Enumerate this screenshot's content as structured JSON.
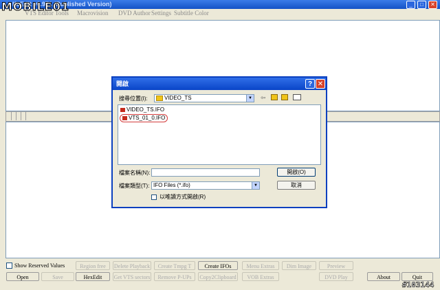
{
  "window": {
    "title": "IfoEdit v0.971 (Published Version)",
    "controls": {
      "minimize": "_",
      "maximize": "□",
      "close": "✕"
    }
  },
  "watermark": {
    "logo": "MOBILE01",
    "id": "#103144"
  },
  "menu": [
    "VTS Editor",
    "Tools",
    "Macrovision",
    "DVD Author",
    "Settings",
    "Subtitle Color"
  ],
  "dialog": {
    "title": "開啟",
    "look_in_label": "搜尋位置(I):",
    "look_in_value": "VIDEO_TS",
    "files": [
      "VIDEO_TS.IFO",
      "VTS_01_0.IFO"
    ],
    "filename_label": "檔案名稱(N):",
    "filename_value": "",
    "filetype_label": "檔案類型(T):",
    "filetype_value": "IFO Files (*.ifo)",
    "readonly_label": "以唯讀方式開啟(R)",
    "open_button": "開啟(O)",
    "cancel_button": "取消",
    "help_button": "?",
    "close_button": "✕"
  },
  "bottom": {
    "show_reserved": "Show Reserved Values",
    "buttons_row1": [
      {
        "label": "Region free",
        "enabled": false
      },
      {
        "label": "Delete Playback",
        "enabled": false
      },
      {
        "label": "Create Tmpg T",
        "enabled": false
      },
      {
        "label": "Create IFOs",
        "enabled": true
      },
      {
        "label": "Menu Extras",
        "enabled": false
      },
      {
        "label": "Dim Image",
        "enabled": false
      },
      {
        "label": "Preview",
        "enabled": false
      }
    ],
    "buttons_row2": [
      {
        "label": "Open",
        "enabled": true
      },
      {
        "label": "Save",
        "enabled": false
      },
      {
        "label": "HexEdit",
        "enabled": true
      },
      {
        "label": "Get VTS sectors",
        "enabled": false
      },
      {
        "label": "Remove P-UPs",
        "enabled": false
      },
      {
        "label": "Copy2Clipboard",
        "enabled": false
      },
      {
        "label": "VOB Extras",
        "enabled": false
      },
      {
        "label": "DVD Play",
        "enabled": false
      },
      {
        "label": "About",
        "enabled": true
      },
      {
        "label": "Quit",
        "enabled": true
      }
    ]
  }
}
